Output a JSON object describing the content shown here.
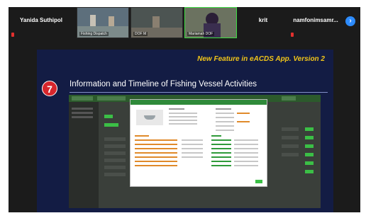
{
  "participants": [
    {
      "name": "Yanida Suthipol"
    },
    {
      "video_label": "Fishing Dispatch"
    },
    {
      "video_label": "DOF M"
    },
    {
      "video_label": "Mariamah DOF"
    },
    {
      "name": "krit"
    },
    {
      "name": "namfonimsamr..."
    }
  ],
  "slide": {
    "banner": "New Feature in eACDS App. Version 2",
    "step_number": "7",
    "title": "Information and Timeline of Fishing Vessel Activities"
  },
  "colors": {
    "banner": "#f0c419",
    "badge": "#d7262c",
    "slide_bg": "#131c44",
    "app_green": "#2f8a3a"
  },
  "icons": {
    "next_page": "chevron-right-icon",
    "mic_muted": "mic-muted-icon"
  }
}
